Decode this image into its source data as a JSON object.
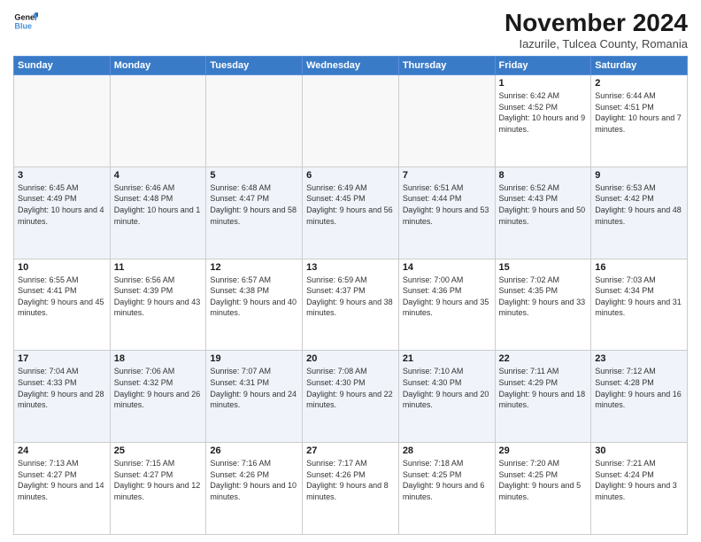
{
  "logo": {
    "line1": "General",
    "line2": "Blue"
  },
  "title": "November 2024",
  "location": "Iazurile, Tulcea County, Romania",
  "days_header": [
    "Sunday",
    "Monday",
    "Tuesday",
    "Wednesday",
    "Thursday",
    "Friday",
    "Saturday"
  ],
  "weeks": [
    {
      "row_class": "normal",
      "days": [
        {
          "num": "",
          "info": ""
        },
        {
          "num": "",
          "info": ""
        },
        {
          "num": "",
          "info": ""
        },
        {
          "num": "",
          "info": ""
        },
        {
          "num": "",
          "info": ""
        },
        {
          "num": "1",
          "info": "Sunrise: 6:42 AM\nSunset: 4:52 PM\nDaylight: 10 hours and 9 minutes."
        },
        {
          "num": "2",
          "info": "Sunrise: 6:44 AM\nSunset: 4:51 PM\nDaylight: 10 hours and 7 minutes."
        }
      ]
    },
    {
      "row_class": "alt",
      "days": [
        {
          "num": "3",
          "info": "Sunrise: 6:45 AM\nSunset: 4:49 PM\nDaylight: 10 hours and 4 minutes."
        },
        {
          "num": "4",
          "info": "Sunrise: 6:46 AM\nSunset: 4:48 PM\nDaylight: 10 hours and 1 minute."
        },
        {
          "num": "5",
          "info": "Sunrise: 6:48 AM\nSunset: 4:47 PM\nDaylight: 9 hours and 58 minutes."
        },
        {
          "num": "6",
          "info": "Sunrise: 6:49 AM\nSunset: 4:45 PM\nDaylight: 9 hours and 56 minutes."
        },
        {
          "num": "7",
          "info": "Sunrise: 6:51 AM\nSunset: 4:44 PM\nDaylight: 9 hours and 53 minutes."
        },
        {
          "num": "8",
          "info": "Sunrise: 6:52 AM\nSunset: 4:43 PM\nDaylight: 9 hours and 50 minutes."
        },
        {
          "num": "9",
          "info": "Sunrise: 6:53 AM\nSunset: 4:42 PM\nDaylight: 9 hours and 48 minutes."
        }
      ]
    },
    {
      "row_class": "normal",
      "days": [
        {
          "num": "10",
          "info": "Sunrise: 6:55 AM\nSunset: 4:41 PM\nDaylight: 9 hours and 45 minutes."
        },
        {
          "num": "11",
          "info": "Sunrise: 6:56 AM\nSunset: 4:39 PM\nDaylight: 9 hours and 43 minutes."
        },
        {
          "num": "12",
          "info": "Sunrise: 6:57 AM\nSunset: 4:38 PM\nDaylight: 9 hours and 40 minutes."
        },
        {
          "num": "13",
          "info": "Sunrise: 6:59 AM\nSunset: 4:37 PM\nDaylight: 9 hours and 38 minutes."
        },
        {
          "num": "14",
          "info": "Sunrise: 7:00 AM\nSunset: 4:36 PM\nDaylight: 9 hours and 35 minutes."
        },
        {
          "num": "15",
          "info": "Sunrise: 7:02 AM\nSunset: 4:35 PM\nDaylight: 9 hours and 33 minutes."
        },
        {
          "num": "16",
          "info": "Sunrise: 7:03 AM\nSunset: 4:34 PM\nDaylight: 9 hours and 31 minutes."
        }
      ]
    },
    {
      "row_class": "alt",
      "days": [
        {
          "num": "17",
          "info": "Sunrise: 7:04 AM\nSunset: 4:33 PM\nDaylight: 9 hours and 28 minutes."
        },
        {
          "num": "18",
          "info": "Sunrise: 7:06 AM\nSunset: 4:32 PM\nDaylight: 9 hours and 26 minutes."
        },
        {
          "num": "19",
          "info": "Sunrise: 7:07 AM\nSunset: 4:31 PM\nDaylight: 9 hours and 24 minutes."
        },
        {
          "num": "20",
          "info": "Sunrise: 7:08 AM\nSunset: 4:30 PM\nDaylight: 9 hours and 22 minutes."
        },
        {
          "num": "21",
          "info": "Sunrise: 7:10 AM\nSunset: 4:30 PM\nDaylight: 9 hours and 20 minutes."
        },
        {
          "num": "22",
          "info": "Sunrise: 7:11 AM\nSunset: 4:29 PM\nDaylight: 9 hours and 18 minutes."
        },
        {
          "num": "23",
          "info": "Sunrise: 7:12 AM\nSunset: 4:28 PM\nDaylight: 9 hours and 16 minutes."
        }
      ]
    },
    {
      "row_class": "normal",
      "days": [
        {
          "num": "24",
          "info": "Sunrise: 7:13 AM\nSunset: 4:27 PM\nDaylight: 9 hours and 14 minutes."
        },
        {
          "num": "25",
          "info": "Sunrise: 7:15 AM\nSunset: 4:27 PM\nDaylight: 9 hours and 12 minutes."
        },
        {
          "num": "26",
          "info": "Sunrise: 7:16 AM\nSunset: 4:26 PM\nDaylight: 9 hours and 10 minutes."
        },
        {
          "num": "27",
          "info": "Sunrise: 7:17 AM\nSunset: 4:26 PM\nDaylight: 9 hours and 8 minutes."
        },
        {
          "num": "28",
          "info": "Sunrise: 7:18 AM\nSunset: 4:25 PM\nDaylight: 9 hours and 6 minutes."
        },
        {
          "num": "29",
          "info": "Sunrise: 7:20 AM\nSunset: 4:25 PM\nDaylight: 9 hours and 5 minutes."
        },
        {
          "num": "30",
          "info": "Sunrise: 7:21 AM\nSunset: 4:24 PM\nDaylight: 9 hours and 3 minutes."
        }
      ]
    }
  ]
}
